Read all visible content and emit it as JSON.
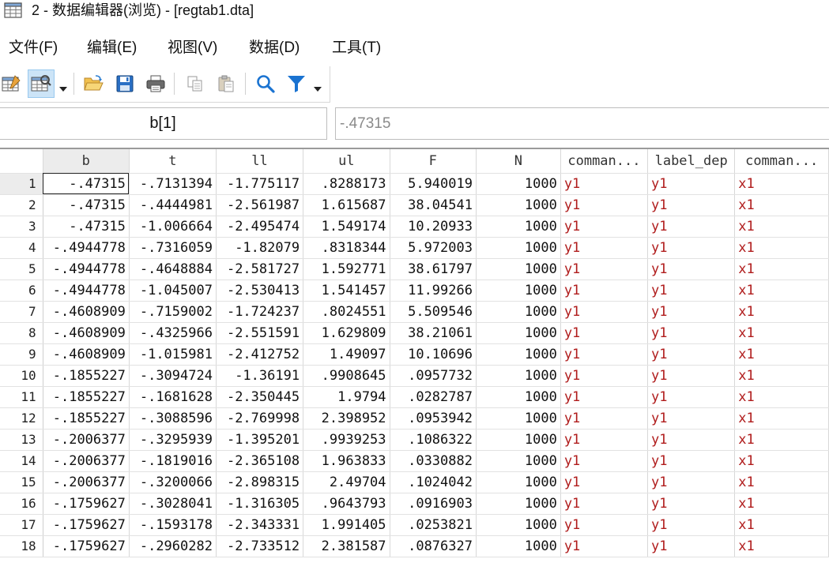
{
  "window": {
    "title": "2 - 数据编辑器(浏览) - [regtab1.dta]"
  },
  "menu": [
    "文件(F)",
    "编辑(E)",
    "视图(V)",
    "数据(D)",
    "工具(T)"
  ],
  "toolbar": {
    "buttons": [
      "data-editor-edit-icon",
      "data-editor-browse-icon",
      "open-icon",
      "save-icon",
      "print-icon",
      "copy-icon",
      "paste-icon",
      "search-icon",
      "filter-icon"
    ]
  },
  "cell_ref": {
    "name": "b[1]",
    "value": "-.47315"
  },
  "grid": {
    "columns": [
      "b",
      "t",
      "ll",
      "ul",
      "F",
      "N",
      "comman...",
      "label_dep",
      "comman..."
    ],
    "rows": [
      [
        "1",
        "-.47315",
        "-.7131394",
        "-1.775117",
        ".8288173",
        "5.940019",
        "1000",
        "y1",
        "y1",
        "x1"
      ],
      [
        "2",
        "-.47315",
        "-.4444981",
        "-2.561987",
        "1.615687",
        "38.04541",
        "1000",
        "y1",
        "y1",
        "x1"
      ],
      [
        "3",
        "-.47315",
        "-1.006664",
        "-2.495474",
        "1.549174",
        "10.20933",
        "1000",
        "y1",
        "y1",
        "x1"
      ],
      [
        "4",
        "-.4944778",
        "-.7316059",
        "-1.82079",
        ".8318344",
        "5.972003",
        "1000",
        "y1",
        "y1",
        "x1"
      ],
      [
        "5",
        "-.4944778",
        "-.4648884",
        "-2.581727",
        "1.592771",
        "38.61797",
        "1000",
        "y1",
        "y1",
        "x1"
      ],
      [
        "6",
        "-.4944778",
        "-1.045007",
        "-2.530413",
        "1.541457",
        "11.99266",
        "1000",
        "y1",
        "y1",
        "x1"
      ],
      [
        "7",
        "-.4608909",
        "-.7159002",
        "-1.724237",
        ".8024551",
        "5.509546",
        "1000",
        "y1",
        "y1",
        "x1"
      ],
      [
        "8",
        "-.4608909",
        "-.4325966",
        "-2.551591",
        "1.629809",
        "38.21061",
        "1000",
        "y1",
        "y1",
        "x1"
      ],
      [
        "9",
        "-.4608909",
        "-1.015981",
        "-2.412752",
        "1.49097",
        "10.10696",
        "1000",
        "y1",
        "y1",
        "x1"
      ],
      [
        "10",
        "-.1855227",
        "-.3094724",
        "-1.36191",
        ".9908645",
        ".0957732",
        "1000",
        "y1",
        "y1",
        "x1"
      ],
      [
        "11",
        "-.1855227",
        "-.1681628",
        "-2.350445",
        "1.9794",
        ".0282787",
        "1000",
        "y1",
        "y1",
        "x1"
      ],
      [
        "12",
        "-.1855227",
        "-.3088596",
        "-2.769998",
        "2.398952",
        ".0953942",
        "1000",
        "y1",
        "y1",
        "x1"
      ],
      [
        "13",
        "-.2006377",
        "-.3295939",
        "-1.395201",
        ".9939253",
        ".1086322",
        "1000",
        "y1",
        "y1",
        "x1"
      ],
      [
        "14",
        "-.2006377",
        "-.1819016",
        "-2.365108",
        "1.963833",
        ".0330882",
        "1000",
        "y1",
        "y1",
        "x1"
      ],
      [
        "15",
        "-.2006377",
        "-.3200066",
        "-2.898315",
        "2.49704",
        ".1024042",
        "1000",
        "y1",
        "y1",
        "x1"
      ],
      [
        "16",
        "-.1759627",
        "-.3028041",
        "-1.316305",
        ".9643793",
        ".0916903",
        "1000",
        "y1",
        "y1",
        "x1"
      ],
      [
        "17",
        "-.1759627",
        "-.1593178",
        "-2.343331",
        "1.991405",
        ".0253821",
        "1000",
        "y1",
        "y1",
        "x1"
      ],
      [
        "18",
        "-.1759627",
        "-.2960282",
        "-2.733512",
        "2.381587",
        ".0876327",
        "1000",
        "y1",
        "y1",
        "x1"
      ]
    ]
  },
  "colors": {
    "string_text": "#b01c1c",
    "active_button": "#cce4f7",
    "filter_icon": "#1a73d1"
  }
}
